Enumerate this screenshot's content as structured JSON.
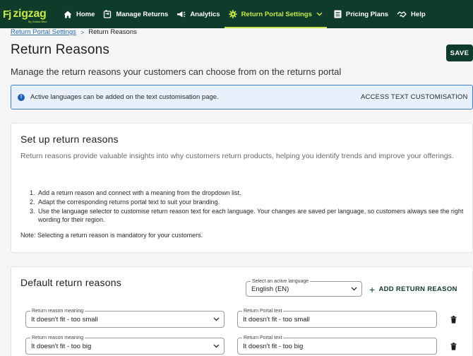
{
  "brand": {
    "name": "zigzag",
    "mark": "Fj",
    "tagline": "By Global Blue"
  },
  "nav": {
    "items": [
      {
        "label": "Home",
        "icon": "home-icon"
      },
      {
        "label": "Manage Returns",
        "icon": "returns-icon"
      },
      {
        "label": "Analytics",
        "icon": "megaphone-icon"
      },
      {
        "label": "Return Portal Settings",
        "icon": "gear-icon",
        "active": true
      },
      {
        "label": "Pricing Plans",
        "icon": "document-icon"
      },
      {
        "label": "Help",
        "icon": "handshake-icon"
      }
    ]
  },
  "breadcrumb": {
    "parent": "Return Portal Settings",
    "separator": ">",
    "current": "Return Reasons"
  },
  "page": {
    "title": "Return Reasons",
    "save_label": "SAVE",
    "subtitle": "Manage the return reasons your customers can choose from on the returns portal"
  },
  "info_banner": {
    "text": "Active languages can be added on the text customisation page.",
    "link": "ACCESS TEXT CUSTOMISATION"
  },
  "setup": {
    "heading": "Set up return reasons",
    "description": "Return reasons provide valuable insights into why customers return products, helping you identify trends and improve your offerings.",
    "steps": [
      "Add a return reason and connect with a meaning from the dropdown list.",
      "Adapt the corresponding returns portal text to suit your branding.",
      "Use the language selector to customise return reason text for each language. Your changes are saved per language, so customers always see the right wording for their region."
    ],
    "note": "Note: Selecting a return reason is mandatory for your customers."
  },
  "reasons": {
    "heading": "Default return reasons",
    "language_label": "Select an active language",
    "language_value": "English (EN)",
    "add_label": "ADD RETURN REASON",
    "meaning_label": "Return reason meaning",
    "portal_text_label": "Return Portal text",
    "rows": [
      {
        "meaning": "It doesn't fit - too small",
        "portal_text": "It doesn't fit - too small"
      },
      {
        "meaning": "It doesn't fit - too big",
        "portal_text": "It doesn't fit - too big"
      }
    ]
  },
  "colors": {
    "nav_bg": "#0e3b2a",
    "accent": "#c7e84a",
    "link": "#2f6da8",
    "banner_bg": "#e7f0fb",
    "banner_border": "#3d7fc9"
  }
}
